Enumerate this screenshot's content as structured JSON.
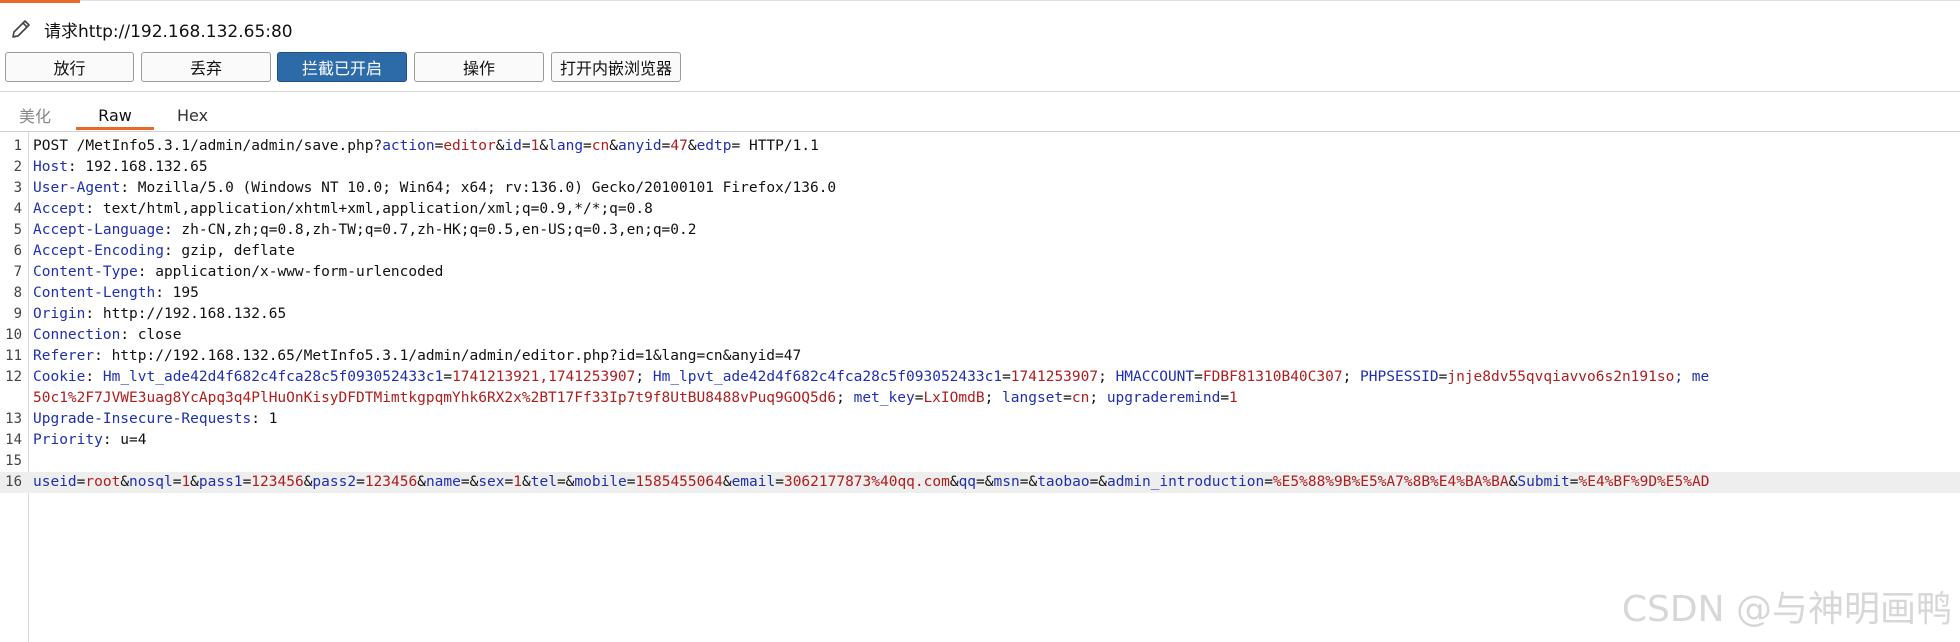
{
  "header": {
    "title": "请求http://192.168.132.65:80",
    "icon": "pencil-icon"
  },
  "toolbar": {
    "forward_label": "放行",
    "drop_label": "丢弃",
    "intercept_label": "拦截已开启",
    "action_label": "操作",
    "browser_label": "打开内嵌浏览器"
  },
  "tabs": {
    "pretty": "美化",
    "raw": "Raw",
    "hex": "Hex"
  },
  "editor": {
    "line_numbers": [
      "1",
      "2",
      "3",
      "4",
      "5",
      "6",
      "7",
      "8",
      "9",
      "10",
      "11",
      "12",
      "",
      "13",
      "14",
      "15",
      "16"
    ],
    "lines": [
      [
        {
          "t": "POST /MetInfo5.3.1/admin/admin/save.php?",
          "c": "p"
        },
        {
          "t": "action",
          "c": "k"
        },
        {
          "t": "=",
          "c": "p"
        },
        {
          "t": "editor",
          "c": "v"
        },
        {
          "t": "&",
          "c": "p"
        },
        {
          "t": "id",
          "c": "k"
        },
        {
          "t": "=",
          "c": "p"
        },
        {
          "t": "1",
          "c": "v"
        },
        {
          "t": "&",
          "c": "p"
        },
        {
          "t": "lang",
          "c": "k"
        },
        {
          "t": "=",
          "c": "p"
        },
        {
          "t": "cn",
          "c": "v"
        },
        {
          "t": "&",
          "c": "p"
        },
        {
          "t": "anyid",
          "c": "k"
        },
        {
          "t": "=",
          "c": "p"
        },
        {
          "t": "47",
          "c": "v"
        },
        {
          "t": "&",
          "c": "p"
        },
        {
          "t": "edtp",
          "c": "k"
        },
        {
          "t": "= HTTP/1.1",
          "c": "p"
        }
      ],
      [
        {
          "t": "Host",
          "c": "k"
        },
        {
          "t": ": 192.168.132.65",
          "c": "p"
        }
      ],
      [
        {
          "t": "User-Agent",
          "c": "k"
        },
        {
          "t": ": Mozilla/5.0 (Windows NT 10.0; Win64; x64; rv:136.0) Gecko/20100101 Firefox/136.0",
          "c": "p"
        }
      ],
      [
        {
          "t": "Accept",
          "c": "k"
        },
        {
          "t": ": text/html,application/xhtml+xml,application/xml;q=0.9,*/*;q=0.8",
          "c": "p"
        }
      ],
      [
        {
          "t": "Accept-Language",
          "c": "k"
        },
        {
          "t": ": zh-CN,zh;q=0.8,zh-TW;q=0.7,zh-HK;q=0.5,en-US;q=0.3,en;q=0.2",
          "c": "p"
        }
      ],
      [
        {
          "t": "Accept-Encoding",
          "c": "k"
        },
        {
          "t": ": gzip, deflate",
          "c": "p"
        }
      ],
      [
        {
          "t": "Content-Type",
          "c": "k"
        },
        {
          "t": ": application/x-www-form-urlencoded",
          "c": "p"
        }
      ],
      [
        {
          "t": "Content-Length",
          "c": "k"
        },
        {
          "t": ": 195",
          "c": "p"
        }
      ],
      [
        {
          "t": "Origin",
          "c": "k"
        },
        {
          "t": ": http://192.168.132.65",
          "c": "p"
        }
      ],
      [
        {
          "t": "Connection",
          "c": "k"
        },
        {
          "t": ": close",
          "c": "p"
        }
      ],
      [
        {
          "t": "Referer",
          "c": "k"
        },
        {
          "t": ": http://192.168.132.65/MetInfo5.3.1/admin/admin/editor.php?id=1&lang=cn&anyid=47",
          "c": "p"
        }
      ],
      [
        {
          "t": "Cookie",
          "c": "k"
        },
        {
          "t": ": ",
          "c": "p"
        },
        {
          "t": "Hm_lvt_ade42d4f682c4fca28c5f093052433c1",
          "c": "k"
        },
        {
          "t": "=",
          "c": "p"
        },
        {
          "t": "1741213921,1741253907",
          "c": "v"
        },
        {
          "t": "; ",
          "c": "p"
        },
        {
          "t": "Hm_lpvt_ade42d4f682c4fca28c5f093052433c1",
          "c": "k"
        },
        {
          "t": "=",
          "c": "p"
        },
        {
          "t": "1741253907",
          "c": "v"
        },
        {
          "t": "; ",
          "c": "p"
        },
        {
          "t": "HMACCOUNT",
          "c": "k"
        },
        {
          "t": "=",
          "c": "p"
        },
        {
          "t": "FDBF81310B40C307",
          "c": "v"
        },
        {
          "t": "; ",
          "c": "p"
        },
        {
          "t": "PHPSESSID",
          "c": "k"
        },
        {
          "t": "=",
          "c": "p"
        },
        {
          "t": "jnje8dv55qvqiavvo6s2n191so",
          "c": "v"
        },
        {
          "t": "; me",
          "c": "k"
        }
      ],
      [
        {
          "t": "50c1%2F7JVWE3uag8YcApq3q4PlHuOnKisyDFDTMimtkgpqmYhk6RX2x%2BT17Ff33Ip7t9f8UtBU8488vPuq9GOQ5d6",
          "c": "v"
        },
        {
          "t": "; ",
          "c": "p"
        },
        {
          "t": "met_key",
          "c": "k"
        },
        {
          "t": "=",
          "c": "p"
        },
        {
          "t": "LxIOmdB",
          "c": "v"
        },
        {
          "t": "; ",
          "c": "p"
        },
        {
          "t": "langset",
          "c": "k"
        },
        {
          "t": "=",
          "c": "p"
        },
        {
          "t": "cn",
          "c": "v"
        },
        {
          "t": "; ",
          "c": "p"
        },
        {
          "t": "upgraderemind",
          "c": "k"
        },
        {
          "t": "=",
          "c": "p"
        },
        {
          "t": "1",
          "c": "v"
        }
      ],
      [
        {
          "t": "Upgrade-Insecure-Requests",
          "c": "k"
        },
        {
          "t": ": 1",
          "c": "p"
        }
      ],
      [
        {
          "t": "Priority",
          "c": "k"
        },
        {
          "t": ": u=4",
          "c": "p"
        }
      ],
      [],
      [
        {
          "t": "useid",
          "c": "k"
        },
        {
          "t": "=",
          "c": "p"
        },
        {
          "t": "root",
          "c": "v"
        },
        {
          "t": "&",
          "c": "p"
        },
        {
          "t": "nosql",
          "c": "k"
        },
        {
          "t": "=",
          "c": "p"
        },
        {
          "t": "1",
          "c": "v"
        },
        {
          "t": "&",
          "c": "p"
        },
        {
          "t": "pass1",
          "c": "k"
        },
        {
          "t": "=",
          "c": "p"
        },
        {
          "t": "123456",
          "c": "v"
        },
        {
          "t": "&",
          "c": "p"
        },
        {
          "t": "pass2",
          "c": "k"
        },
        {
          "t": "=",
          "c": "p"
        },
        {
          "t": "123456",
          "c": "v"
        },
        {
          "t": "&",
          "c": "p"
        },
        {
          "t": "name",
          "c": "k"
        },
        {
          "t": "=&",
          "c": "p"
        },
        {
          "t": "sex",
          "c": "k"
        },
        {
          "t": "=",
          "c": "p"
        },
        {
          "t": "1",
          "c": "v"
        },
        {
          "t": "&",
          "c": "p"
        },
        {
          "t": "tel",
          "c": "k"
        },
        {
          "t": "=&",
          "c": "p"
        },
        {
          "t": "mobile",
          "c": "k"
        },
        {
          "t": "=",
          "c": "p"
        },
        {
          "t": "1585455064",
          "c": "v"
        },
        {
          "t": "&",
          "c": "p"
        },
        {
          "t": "email",
          "c": "k"
        },
        {
          "t": "=",
          "c": "p"
        },
        {
          "t": "3062177873%40qq.com",
          "c": "v"
        },
        {
          "t": "&",
          "c": "p"
        },
        {
          "t": "qq",
          "c": "k"
        },
        {
          "t": "=&",
          "c": "p"
        },
        {
          "t": "msn",
          "c": "k"
        },
        {
          "t": "=&",
          "c": "p"
        },
        {
          "t": "taobao",
          "c": "k"
        },
        {
          "t": "=&",
          "c": "p"
        },
        {
          "t": "admin_introduction",
          "c": "k"
        },
        {
          "t": "=",
          "c": "p"
        },
        {
          "t": "%E5%88%9B%E5%A7%8B%E4%BA%BA",
          "c": "v"
        },
        {
          "t": "&",
          "c": "p"
        },
        {
          "t": "Submit",
          "c": "k"
        },
        {
          "t": "=",
          "c": "p"
        },
        {
          "t": "%E4%BF%9D%E5%AD",
          "c": "v"
        }
      ]
    ],
    "highlight_index": 16
  },
  "watermark": "CSDN @与神明画鸭",
  "colors": {
    "accent": "#e8672a",
    "active_button": "#2d6aa8",
    "key": "#1f2fb0",
    "value": "#b01d1d"
  }
}
